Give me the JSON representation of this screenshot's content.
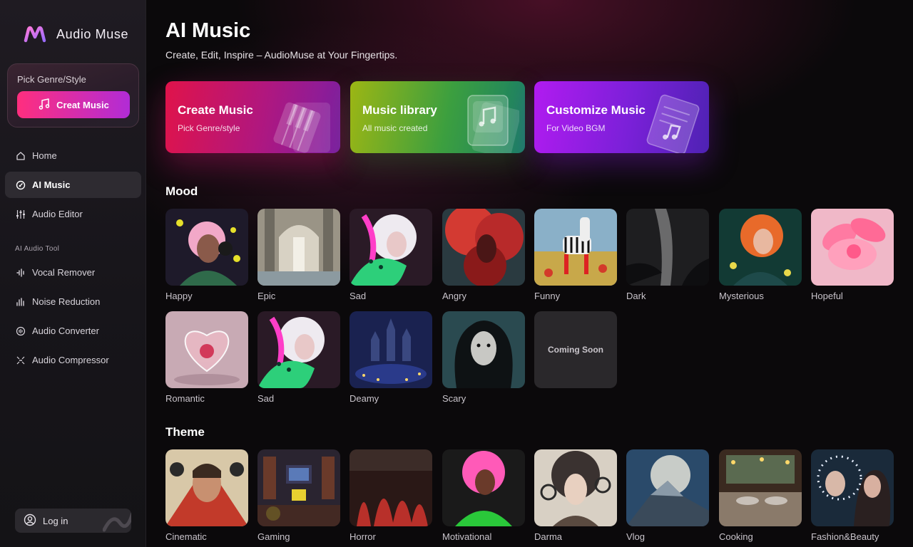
{
  "app": {
    "name": "Audio Muse"
  },
  "sidebar": {
    "promo": {
      "title": "Pick Genre/Style",
      "button_label": "Creat Music"
    },
    "nav": [
      {
        "label": "Home",
        "icon": "home-icon"
      },
      {
        "label": "AI Music",
        "icon": "ai-music-icon",
        "active": true
      },
      {
        "label": "Audio Editor",
        "icon": "equalizer-icon"
      }
    ],
    "tools_label": "AI Audio Tool",
    "tools": [
      {
        "label": "Vocal Remover",
        "icon": "vocal-remover-icon"
      },
      {
        "label": "Noise Reduction",
        "icon": "noise-reduction-icon"
      },
      {
        "label": "Audio Converter",
        "icon": "audio-converter-icon"
      },
      {
        "label": "Audio Compressor",
        "icon": "audio-compressor-icon"
      }
    ],
    "login_label": "Log in"
  },
  "main": {
    "title": "AI Music",
    "subtitle": "Create, Edit, Inspire – AudioMuse at Your Fingertips.",
    "cards": [
      {
        "title": "Create Music",
        "subtitle": "Pick Genre/style",
        "icon": "piano-keys-icon",
        "color": "#e0134a"
      },
      {
        "title": "Music library",
        "subtitle": "All music created",
        "icon": "music-note-icon",
        "color": "#9cb614"
      },
      {
        "title": "Customize Music",
        "subtitle": "For Video BGM",
        "icon": "music-sheet-icon",
        "color": "#b11bf0"
      }
    ],
    "mood_title": "Mood",
    "mood": [
      "Happy",
      "Epic",
      "Sad",
      "Angry",
      "Funny",
      "Dark",
      "Mysterious",
      "Hopeful",
      "Romantic",
      "Sad",
      "Deamy",
      "Scary"
    ],
    "coming_soon": "Coming Soon",
    "theme_title": "Theme",
    "theme": [
      "Cinematic",
      "Gaming",
      "Horror",
      "Motivational",
      "Darma",
      "Vlog",
      "Cooking",
      "Fashion&Beauty"
    ]
  }
}
